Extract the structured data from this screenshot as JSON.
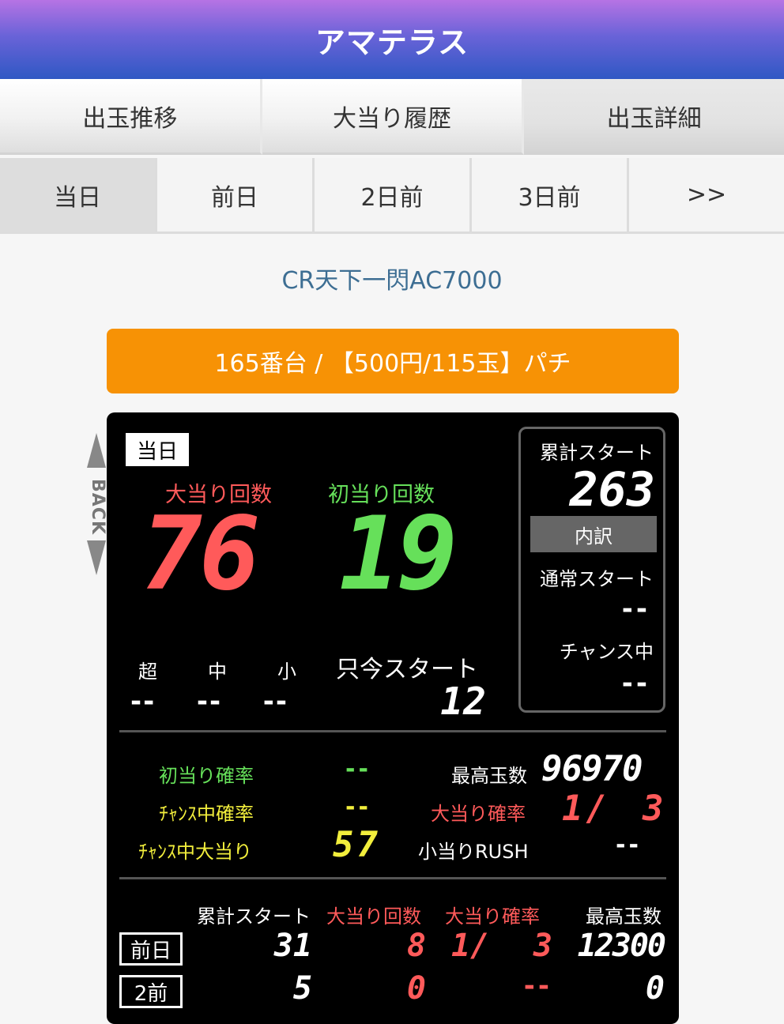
{
  "header": {
    "title": "アマテラス"
  },
  "tabs": [
    {
      "label": "出玉推移",
      "active": false
    },
    {
      "label": "大当り履歴",
      "active": false
    },
    {
      "label": "出玉詳細",
      "active": true
    }
  ],
  "day_tabs": [
    {
      "label": "当日",
      "active": true
    },
    {
      "label": "前日",
      "active": false
    },
    {
      "label": "2日前",
      "active": false
    },
    {
      "label": "3日前",
      "active": false
    },
    {
      "label": ">>",
      "active": false
    }
  ],
  "machine": {
    "name": "CR天下一閃AC7000"
  },
  "info_bar": {
    "text": "165番台 / 【500円/115玉】パチ"
  },
  "back": {
    "label": "BACK"
  },
  "panel": {
    "day_badge": "当日",
    "jackpot_count_label": "大当り回数",
    "jackpot_count": "76",
    "first_hit_label": "初当り回数",
    "first_hit": "19",
    "size_labels": [
      "超",
      "中",
      "小"
    ],
    "size_values": [
      "--",
      "--",
      "--"
    ],
    "current_start_label": "只今スタート",
    "current_start": "12",
    "side": {
      "total_start_label": "累計スタート",
      "total_start": "263",
      "detail_label": "内訳",
      "normal_start_label": "通常スタート",
      "normal_start": "--",
      "chance_label": "チャンス中",
      "chance": "--"
    },
    "stats": {
      "first_hit_rate_label": "初当り確率",
      "first_hit_rate": "--",
      "max_balls_label": "最高玉数",
      "max_balls": "96970",
      "chance_rate_label": "ﾁｬﾝｽ中確率",
      "chance_rate": "--",
      "jackpot_rate_label": "大当り確率",
      "jackpot_rate_prefix": "1/",
      "jackpot_rate": "3",
      "chance_jackpot_label": "ﾁｬﾝｽ中大当り",
      "chance_jackpot": "57",
      "small_rush_label": "小当りRUSH",
      "small_rush": "--"
    },
    "history": {
      "headers": [
        "累計スタート",
        "大当り回数",
        "大当り確率",
        "最高玉数"
      ],
      "rows": [
        {
          "tag": "前日",
          "start": "31",
          "jackpots": "8",
          "rate_prefix": "1/",
          "rate": "3",
          "max": "12300"
        },
        {
          "tag": "2前",
          "start": "5",
          "jackpots": "0",
          "rate_prefix": "",
          "rate": "--",
          "max": "0"
        }
      ]
    }
  },
  "colors": {
    "red": "#ff5a5a",
    "green": "#66e05a",
    "yellow": "#f2ee3c",
    "orange": "#f79205"
  }
}
